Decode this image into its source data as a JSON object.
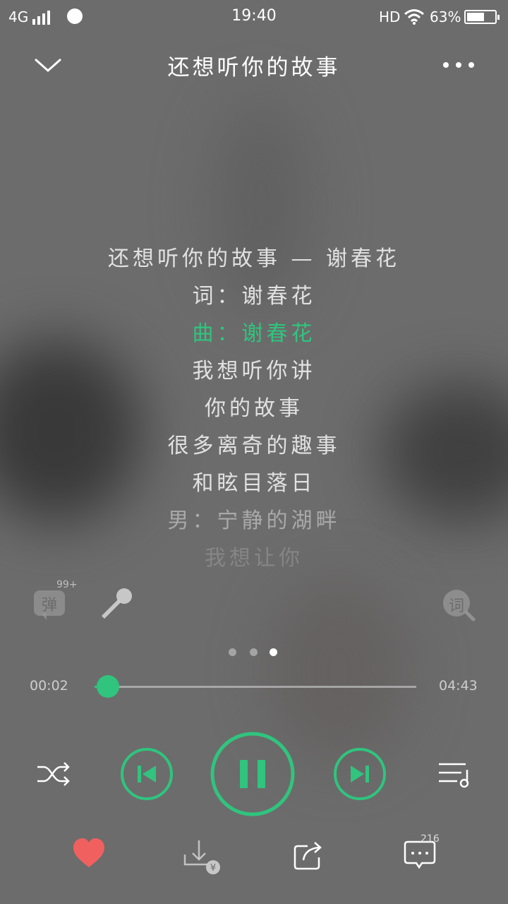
{
  "status_bar": {
    "network": "4G",
    "time": "19:40",
    "hd": "HD",
    "battery": "63%",
    "battery_level": 0.63
  },
  "header": {
    "title": "还想听你的故事"
  },
  "lyrics": [
    "还想听你的故事 — 谢春花",
    "词：谢春花",
    "曲：谢春花",
    "我想听你讲",
    "你的故事",
    "很多离奇的趣事",
    "和眩目落日",
    "男：宁静的湖畔",
    "我想让你"
  ],
  "current_lyric_index": 2,
  "tools": {
    "danmu_label": "弹",
    "danmu_badge": "99+",
    "lyric_search_label": "词"
  },
  "pager": {
    "count": 3,
    "active": 2
  },
  "progress": {
    "current": "00:02",
    "total": "04:43",
    "fraction": 0.007
  },
  "comments": {
    "count": "216"
  },
  "colors": {
    "accent": "#30c47e",
    "heart": "#f0605f"
  },
  "icons": [
    "chevron-down-icon",
    "more-icon",
    "danmu-icon",
    "microphone-icon",
    "lyric-search-icon",
    "shuffle-icon",
    "previous-icon",
    "pause-icon",
    "next-icon",
    "playlist-icon",
    "heart-icon",
    "download-paid-icon",
    "share-icon",
    "comment-icon"
  ]
}
